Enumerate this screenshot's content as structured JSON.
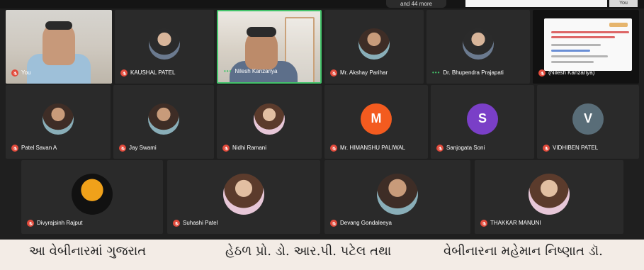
{
  "top_bar": {
    "pill_label": "and 44 more",
    "you_label": "You"
  },
  "tiles": {
    "row1": [
      {
        "name": "You"
      },
      {
        "name": "KAUSHAL PATEL"
      },
      {
        "name": "Nilesh Kanzariya"
      },
      {
        "name": "Mr. Akshay Parihar"
      },
      {
        "name": "Dr. Bhupendra Prajapati"
      },
      {
        "name": "(Nilesh Kanzariya)"
      }
    ],
    "row2": [
      {
        "name": "Patel Savan A"
      },
      {
        "name": "Jay Swami"
      },
      {
        "name": "Nidhi Ramani"
      },
      {
        "name": "Mr. HIMANSHU PALIWAL",
        "initial": "M",
        "color": "#f35b1f"
      },
      {
        "name": "Sanjogata Soni",
        "initial": "S",
        "color": "#7a3fc7"
      },
      {
        "name": "VIDHIBEN PATEL",
        "initial": "V",
        "color": "#596d78"
      }
    ],
    "row3": [
      {
        "name": "Divyrajsinh Rajput"
      },
      {
        "name": "Suhashi Patel"
      },
      {
        "name": "Devang Gondaleeya"
      },
      {
        "name": "THAKKAR MANUNI"
      }
    ]
  },
  "caption": {
    "col1": "આ વેબીનારમાં ગુજરાત",
    "col2": "હેઠળ પ્રો. ડો. આર.પી. પટેલ તથા",
    "col3": "વેબીનારના મહેમાન નિષ્ણાત ડૉ."
  },
  "colors": {
    "mic_muted": "#e24a3b",
    "active_speaker": "#43c36a",
    "background": "#1f1f1f"
  }
}
